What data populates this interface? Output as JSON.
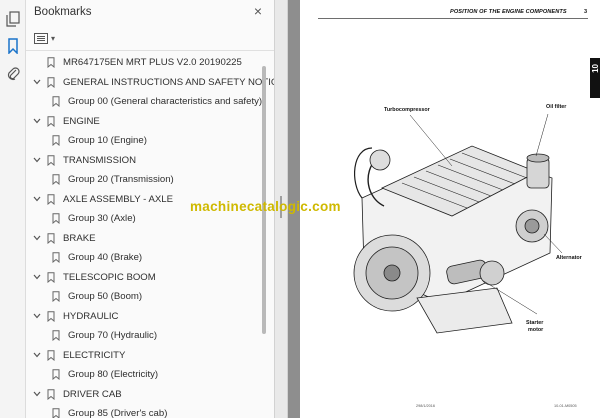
{
  "toolbar": {
    "tools": [
      {
        "name": "pages-icon"
      },
      {
        "name": "bookmark-icon"
      },
      {
        "name": "attachment-icon"
      }
    ]
  },
  "bookmarks_panel": {
    "title": "Bookmarks",
    "close_glyph": "×",
    "options_glyph": "▾",
    "items": [
      {
        "label": "MR647175EN MRT PLUS V2.0 20190225",
        "level": 0,
        "expandable": false
      },
      {
        "label": "GENERAL INSTRUCTIONS AND SAFETY NOTICE",
        "level": 0,
        "expandable": true,
        "expanded": true
      },
      {
        "label": "Group 00 (General characteristics and safety)",
        "level": 1,
        "expandable": false
      },
      {
        "label": "ENGINE",
        "level": 0,
        "expandable": true,
        "expanded": true
      },
      {
        "label": "Group 10 (Engine)",
        "level": 1,
        "expandable": false
      },
      {
        "label": "TRANSMISSION",
        "level": 0,
        "expandable": true,
        "expanded": true
      },
      {
        "label": "Group 20 (Transmission)",
        "level": 1,
        "expandable": false
      },
      {
        "label": "AXLE ASSEMBLY - AXLE",
        "level": 0,
        "expandable": true,
        "expanded": true
      },
      {
        "label": "Group 30 (Axle)",
        "level": 1,
        "expandable": false
      },
      {
        "label": "BRAKE",
        "level": 0,
        "expandable": true,
        "expanded": true
      },
      {
        "label": "Group 40 (Brake)",
        "level": 1,
        "expandable": false
      },
      {
        "label": "TELESCOPIC BOOM",
        "level": 0,
        "expandable": true,
        "expanded": true
      },
      {
        "label": "Group 50 (Boom)",
        "level": 1,
        "expandable": false
      },
      {
        "label": "HYDRAULIC",
        "level": 0,
        "expandable": true,
        "expanded": true
      },
      {
        "label": "Group 70 (Hydraulic)",
        "level": 1,
        "expandable": false
      },
      {
        "label": "ELECTRICITY",
        "level": 0,
        "expandable": true,
        "expanded": true
      },
      {
        "label": "Group 80 (Electricity)",
        "level": 1,
        "expandable": false
      },
      {
        "label": "DRIVER CAB",
        "level": 0,
        "expandable": true,
        "expanded": true
      },
      {
        "label": "Group 85 (Driver's cab)",
        "level": 1,
        "expandable": false
      }
    ]
  },
  "document": {
    "header_title": "POSITION OF THE ENGINE COMPONENTS",
    "page_number": "3",
    "chapter_tab": "10",
    "callouts": {
      "turbo": "Turbocompressor",
      "oil_filter": "Oil filter",
      "alternator": "Alternator",
      "starter_1": "Starter",
      "starter_2": "motor"
    },
    "footer_left": "298/1/2016",
    "footer_right": "10-01-M0505",
    "watermark": "machinecatalogic.com"
  },
  "colors": {
    "panel_bg": "#fafafa",
    "viewport_bg": "#8e8e8e",
    "watermark": "#cfb900",
    "tab_black": "#111111"
  }
}
